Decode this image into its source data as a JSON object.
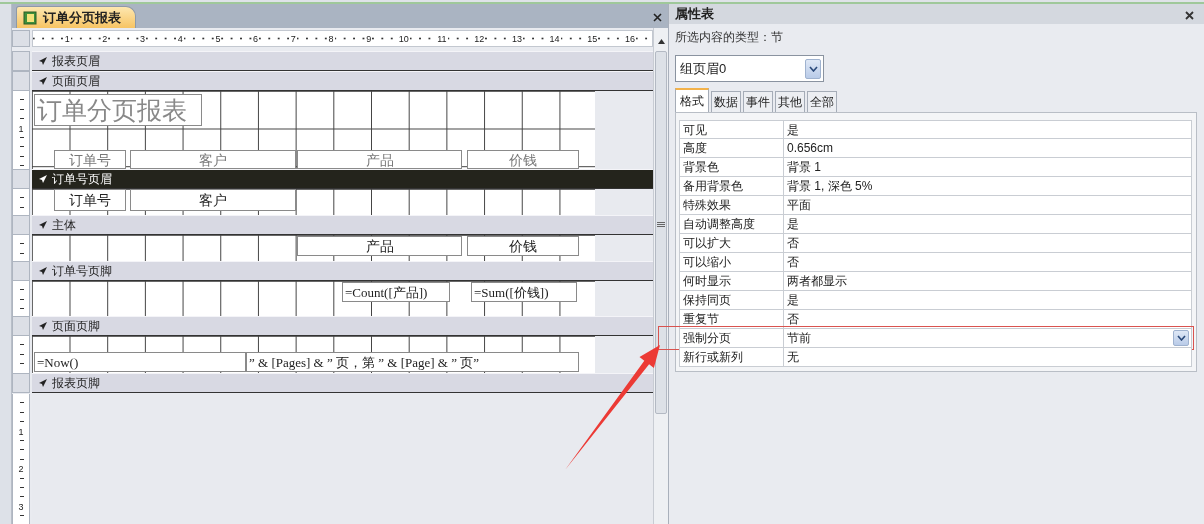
{
  "document_tab": {
    "title": "订单分页报表",
    "selected": true
  },
  "ruler": {
    "marks": [
      "1",
      "2",
      "3",
      "4",
      "5",
      "6",
      "7",
      "8",
      "9",
      "10",
      "11",
      "12",
      "13",
      "14",
      "15",
      "16"
    ]
  },
  "sections": [
    {
      "name": "报表页眉",
      "selected": false
    },
    {
      "name": "页面页眉",
      "selected": false,
      "ruler_labels": [
        "1"
      ],
      "controls": [
        {
          "kind": "title",
          "text": "订单分页报表"
        },
        {
          "kind": "label",
          "text": "订单号"
        },
        {
          "kind": "label",
          "text": "客户"
        },
        {
          "kind": "label",
          "text": "产品"
        },
        {
          "kind": "label",
          "text": "价钱"
        }
      ]
    },
    {
      "name": "订单号页眉",
      "selected": true,
      "controls": [
        {
          "kind": "textbox",
          "text": "订单号"
        },
        {
          "kind": "textbox",
          "text": "客户"
        }
      ]
    },
    {
      "name": "主体",
      "selected": false,
      "controls": [
        {
          "kind": "textbox",
          "text": "产品"
        },
        {
          "kind": "textbox",
          "text": "价钱"
        }
      ]
    },
    {
      "name": "订单号页脚",
      "selected": false,
      "controls": [
        {
          "kind": "formula",
          "text": "=Count([产品])"
        },
        {
          "kind": "formula",
          "text": "=Sum([价钱])"
        }
      ]
    },
    {
      "name": "页面页脚",
      "selected": false,
      "controls": [
        {
          "kind": "formula",
          "text": "=Now()"
        },
        {
          "kind": "formula",
          "text": "” & [Pages] & ” 页，第 ” & [Page] & ” 页”"
        }
      ]
    },
    {
      "name": "报表页脚",
      "selected": false
    }
  ],
  "bottom_ruler_labels": [
    "1",
    "2",
    "3"
  ],
  "property_sheet": {
    "title": "属性表",
    "selection_type": "所选内容的类型：节",
    "object": "组页眉0",
    "tabs": [
      {
        "label": "格式",
        "selected": true
      },
      {
        "label": "数据",
        "selected": false
      },
      {
        "label": "事件",
        "selected": false
      },
      {
        "label": "其他",
        "selected": false
      },
      {
        "label": "全部",
        "selected": false
      }
    ],
    "properties": [
      {
        "name": "可见",
        "value": "是",
        "selected": false,
        "highlighted": false
      },
      {
        "name": "高度",
        "value": "0.656cm",
        "selected": false,
        "highlighted": false
      },
      {
        "name": "背景色",
        "value": "背景 1",
        "selected": false,
        "highlighted": false
      },
      {
        "name": "备用背景色",
        "value": "背景 1, 深色 5%",
        "selected": false,
        "highlighted": false
      },
      {
        "name": "特殊效果",
        "value": "平面",
        "selected": false,
        "highlighted": false
      },
      {
        "name": "自动调整高度",
        "value": "是",
        "selected": false,
        "highlighted": false
      },
      {
        "name": "可以扩大",
        "value": "否",
        "selected": false,
        "highlighted": false
      },
      {
        "name": "可以缩小",
        "value": "否",
        "selected": false,
        "highlighted": false
      },
      {
        "name": "何时显示",
        "value": "两者都显示",
        "selected": false,
        "highlighted": false
      },
      {
        "name": "保持同页",
        "value": "是",
        "selected": false,
        "highlighted": false
      },
      {
        "name": "重复节",
        "value": "否",
        "selected": false,
        "highlighted": false
      },
      {
        "name": "强制分页",
        "value": "节前",
        "selected": true,
        "highlighted": true
      },
      {
        "name": "新行或新列",
        "value": "无",
        "selected": false,
        "highlighted": false
      }
    ]
  }
}
